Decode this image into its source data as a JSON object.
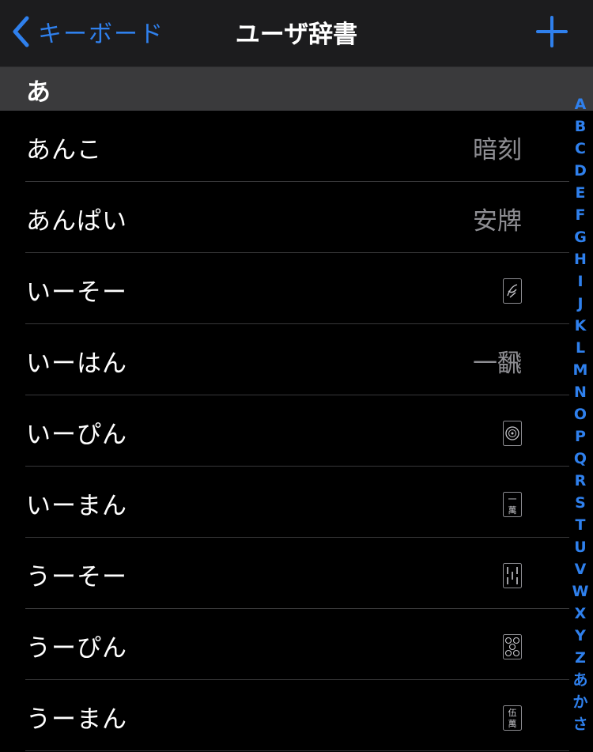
{
  "navbar": {
    "back_label": "キーボード",
    "title": "ユーザ辞書",
    "back_icon": "chevron-left-icon",
    "add_icon": "plus-icon"
  },
  "section": {
    "header": "あ"
  },
  "entries": [
    {
      "reading": "あんこ",
      "word": "暗刻"
    },
    {
      "reading": "あんぱい",
      "word": "安牌"
    },
    {
      "reading": "いーそー",
      "icon": "mahjong-1-bamboo-tile-icon"
    },
    {
      "reading": "いーはん",
      "word": "一飜"
    },
    {
      "reading": "いーぴん",
      "icon": "mahjong-1-circle-tile-icon"
    },
    {
      "reading": "いーまん",
      "icon": "mahjong-1-character-tile-icon",
      "tile_text": [
        "一",
        "萬"
      ]
    },
    {
      "reading": "うーそー",
      "icon": "mahjong-5-bamboo-tile-icon"
    },
    {
      "reading": "うーぴん",
      "icon": "mahjong-5-circle-tile-icon"
    },
    {
      "reading": "うーまん",
      "icon": "mahjong-5-character-tile-icon",
      "tile_text": [
        "伍",
        "萬"
      ]
    }
  ],
  "index": [
    "A",
    "B",
    "C",
    "D",
    "E",
    "F",
    "G",
    "H",
    "I",
    "J",
    "K",
    "L",
    "M",
    "N",
    "O",
    "P",
    "Q",
    "R",
    "S",
    "T",
    "U",
    "V",
    "W",
    "X",
    "Y",
    "Z",
    "あ",
    "か",
    "さ"
  ],
  "colors": {
    "accent": "#2f80ed",
    "background": "#000000",
    "navbar": "#1c1c1e",
    "section_header": "#3a3a3c",
    "secondary_text": "#8e8e93",
    "separator": "#38383a"
  }
}
